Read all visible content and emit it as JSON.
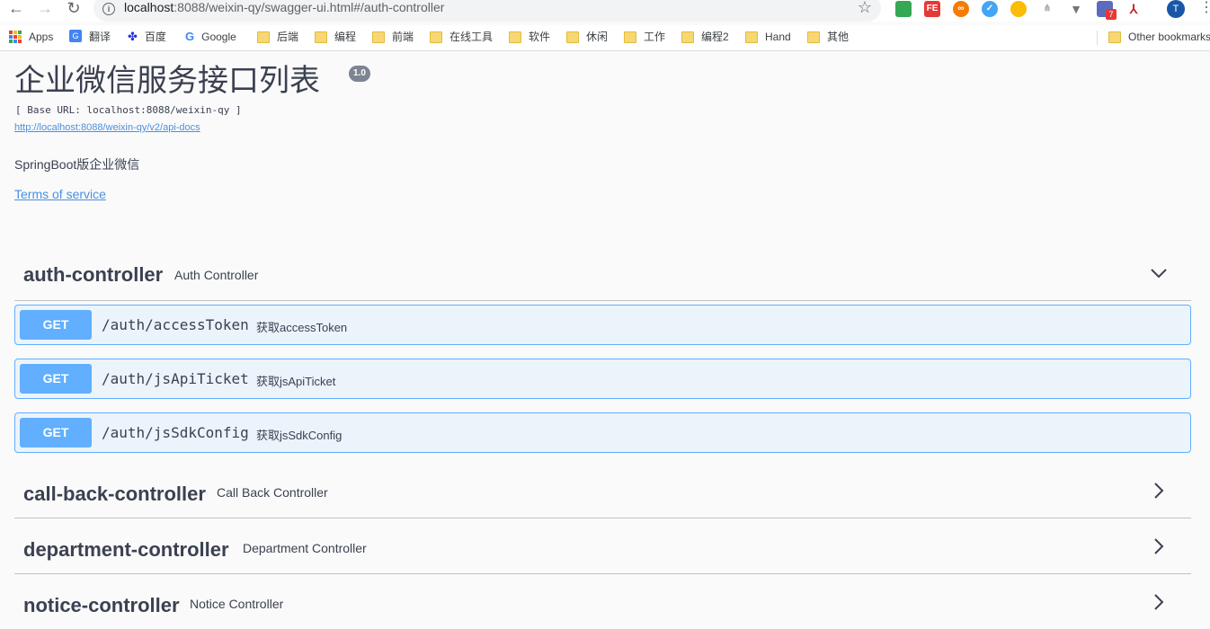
{
  "browser": {
    "url_host": "localhost",
    "url_rest": ":8088/weixin-qy/swagger-ui.html#/auth-controller",
    "avatar_letter": "T",
    "extension_badge": "7",
    "bookmarks": [
      {
        "label": "Apps",
        "icon": "apps-grid-icon"
      },
      {
        "label": "翻译",
        "icon": "translate-icon"
      },
      {
        "label": "百度",
        "icon": "baidu-paw-icon"
      },
      {
        "label": "Google",
        "icon": "google-icon"
      },
      {
        "label": "后端",
        "icon": "folder-icon"
      },
      {
        "label": "编程",
        "icon": "folder-icon"
      },
      {
        "label": "前端",
        "icon": "folder-icon"
      },
      {
        "label": "在线工具",
        "icon": "folder-icon"
      },
      {
        "label": "软件",
        "icon": "folder-icon"
      },
      {
        "label": "休闲",
        "icon": "folder-icon"
      },
      {
        "label": "工作",
        "icon": "folder-icon"
      },
      {
        "label": "编程2",
        "icon": "folder-icon"
      },
      {
        "label": "Hand",
        "icon": "folder-icon"
      },
      {
        "label": "其他",
        "icon": "folder-icon"
      }
    ],
    "other_bookmarks": "Other bookmarks"
  },
  "info": {
    "title": "企业微信服务接口列表",
    "version": "1.0",
    "base_url": "[ Base URL: localhost:8088/weixin-qy ]",
    "api_docs_link": "http://localhost:8088/weixin-qy/v2/api-docs",
    "description": "SpringBoot版企业微信",
    "terms": "Terms of service"
  },
  "tags": [
    {
      "name": "auth-controller",
      "description": "Auth Controller",
      "expanded": true,
      "operations": [
        {
          "method": "GET",
          "path": "/auth/accessToken",
          "summary": "获取accessToken"
        },
        {
          "method": "GET",
          "path": "/auth/jsApiTicket",
          "summary": "获取jsApiTicket"
        },
        {
          "method": "GET",
          "path": "/auth/jsSdkConfig",
          "summary": "获取jsSdkConfig"
        }
      ]
    },
    {
      "name": "call-back-controller",
      "description": "Call Back Controller",
      "expanded": false
    },
    {
      "name": "department-controller",
      "description": "Department Controller",
      "expanded": false
    },
    {
      "name": "notice-controller",
      "description": "Notice Controller",
      "expanded": false
    }
  ],
  "colors": {
    "get_method": "#61affe",
    "get_background": "#ebf3fb",
    "link": "#4990e2",
    "text": "#3b4151"
  }
}
